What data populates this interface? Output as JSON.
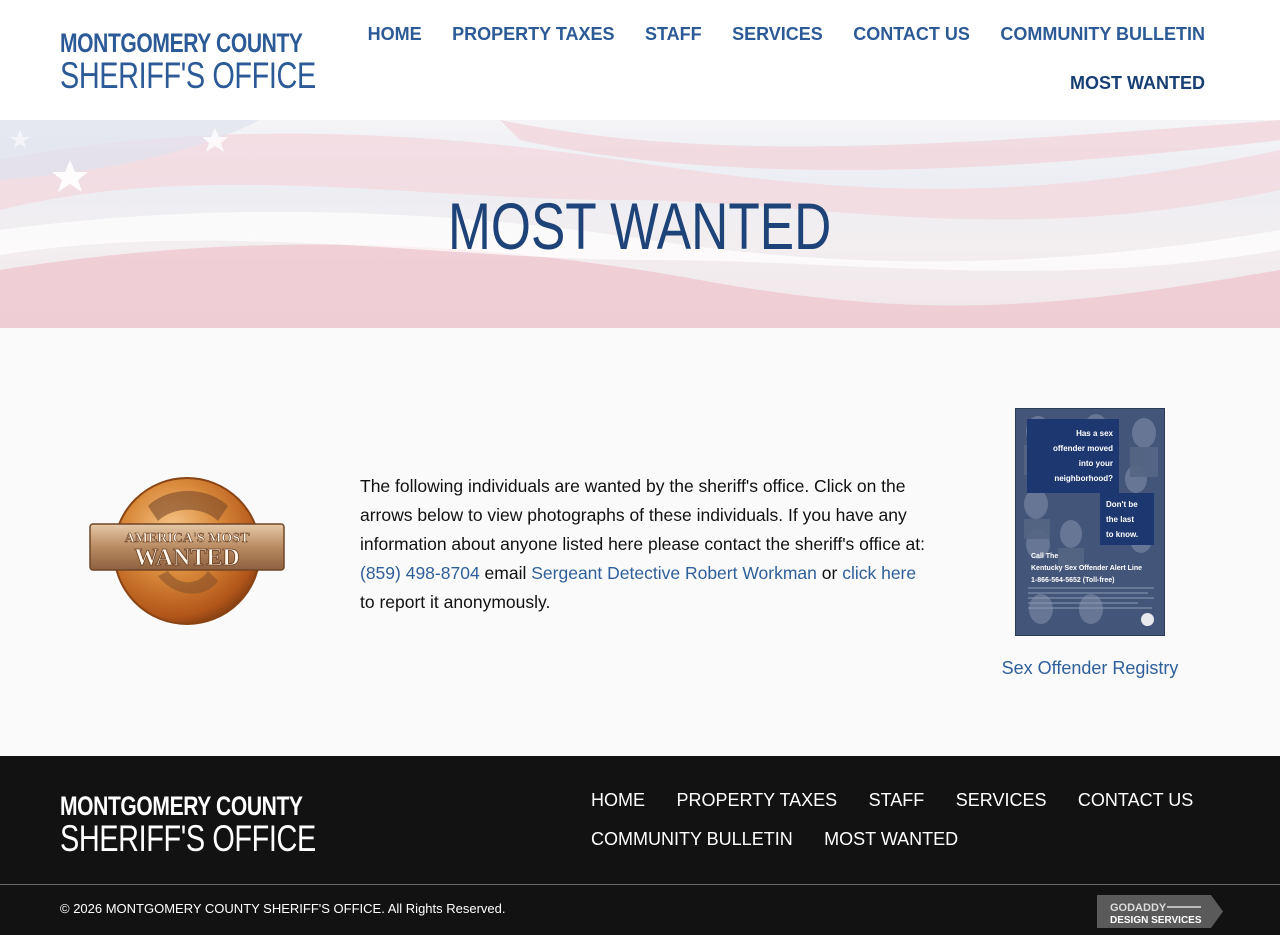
{
  "brand": {
    "line1": "MONTGOMERY COUNTY",
    "line2": "SHERIFF'S OFFICE"
  },
  "nav": {
    "items": [
      {
        "label": "HOME"
      },
      {
        "label": "PROPERTY TAXES"
      },
      {
        "label": "STAFF"
      },
      {
        "label": "SERVICES"
      },
      {
        "label": "CONTACT US"
      },
      {
        "label": "COMMUNITY BULLETIN"
      },
      {
        "label": "MOST WANTED",
        "active": true
      }
    ]
  },
  "hero": {
    "title": "MOST WANTED"
  },
  "main": {
    "badge": {
      "line1": "AMERICA'S MOST",
      "line2": "WANTED"
    },
    "text_before_phone": "The following individuals are wanted by the sheriff's office. Click on the arrows below to view photographs of these individuals. If you have any information about anyone listed here please contact the sheriff's office at:",
    "phone": "(859) 498-8704",
    "text_email": "email",
    "email_link": "Sergeant Detective Robert Workman",
    "text_or": "or",
    "click_here": "click here",
    "text_after": "to report it anonymously.",
    "poster": {
      "q1": "Has a sex",
      "q2": "offender moved",
      "q3": "into your",
      "q4": "neighborhood?",
      "a1": "Don't be",
      "a2": "the last",
      "a3": "to know.",
      "call1": "Call The",
      "call2": "Kentucky Sex Offender Alert Line",
      "call3": "1-866-564-5652 (Toll-free)"
    },
    "registry_link": "Sex Offender Registry"
  },
  "footer": {
    "nav_items": [
      {
        "label": "HOME"
      },
      {
        "label": "PROPERTY TAXES"
      },
      {
        "label": "STAFF"
      },
      {
        "label": "SERVICES"
      },
      {
        "label": "CONTACT US"
      },
      {
        "label": "COMMUNITY BULLETIN"
      },
      {
        "label": "MOST WANTED"
      }
    ],
    "copyright": "© 2026 MONTGOMERY COUNTY SHERIFF'S OFFICE. All Rights Reserved.",
    "godaddy_line1": "GODADDY",
    "godaddy_line2": "DESIGN SERVICES"
  },
  "colors": {
    "brand_blue": "#2b5a96",
    "title_navy": "#1e4378",
    "link_blue": "#2f5f9a",
    "footer_bg": "#121212"
  }
}
